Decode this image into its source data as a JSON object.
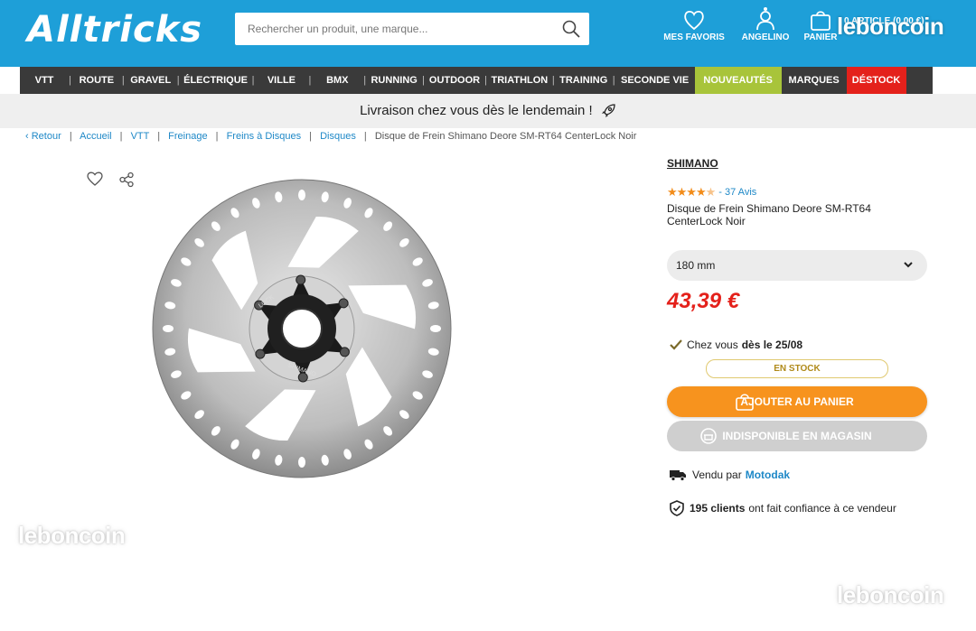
{
  "header": {
    "logo": "Alltricks",
    "search_placeholder": "Rechercher un produit, une marque...",
    "favorites_label": "MES FAVORIS",
    "account_label": "ANGELINO",
    "cart_label": "PANIER",
    "cart_count": "0 ARTICLE (0,00 €)"
  },
  "nav": {
    "items": [
      "VTT",
      "ROUTE",
      "GRAVEL",
      "ÉLECTRIQUE",
      "VILLE",
      "BMX",
      "RUNNING",
      "OUTDOOR",
      "TRIATHLON",
      "TRAINING",
      "SECONDE VIE",
      "NOUVEAUTÉS",
      "MARQUES",
      "DÉSTOCK"
    ],
    "colors": {
      "nouveautes": "#a8c43a",
      "destock": "#e4211b"
    }
  },
  "promo": {
    "text": "Livraison chez vous dès le lendemain !"
  },
  "breadcrumb": {
    "back": "Retour",
    "items": [
      "Accueil",
      "VTT",
      "Freinage",
      "Freins à Disques",
      "Disques"
    ],
    "current": "Disque de Frein Shimano Deore SM-RT64 CenterLock Noir"
  },
  "product": {
    "brand": "SHIMANO",
    "rating": 4.5,
    "reviews": "- 37 Avis",
    "name": "Disque de Frein Shimano Deore SM-RT64 CenterLock Noir",
    "size": "180 mm",
    "price": "43,39 €",
    "delivery_prefix": "Chez vous",
    "delivery_date": "dès le 25/08",
    "stock": "EN STOCK",
    "add_to_cart": "AJOUTER AU PANIER",
    "store_unavailable": "INDISPONIBLE EN MAGASIN",
    "sold_by_prefix": "Vendu par",
    "seller": "Motodak",
    "trust_count": "195 clients",
    "trust_suffix": "ont fait confiance à ce vendeur",
    "hub_text_1": "LOCK",
    "hub_text_2": "SHIMANO"
  },
  "watermarks": {
    "text": "leboncoin"
  },
  "colors": {
    "header": "#1e9fd8",
    "price": "#e4211b",
    "cart_button": "#f7931e",
    "link": "#1e88c7"
  }
}
